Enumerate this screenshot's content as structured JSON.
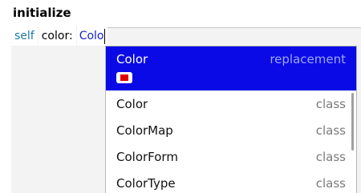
{
  "method": {
    "name": "initialize"
  },
  "code": {
    "receiver": "self",
    "keyword": "color:",
    "typed": "Colo"
  },
  "completion": {
    "selected": {
      "label": "Color",
      "kind": "replacement",
      "swatch_color": "#e00000"
    },
    "items": [
      {
        "label": "Color",
        "kind": "class"
      },
      {
        "label": "ColorMap",
        "kind": "class"
      },
      {
        "label": "ColorForm",
        "kind": "class"
      },
      {
        "label": "ColorType",
        "kind": "class"
      }
    ]
  }
}
